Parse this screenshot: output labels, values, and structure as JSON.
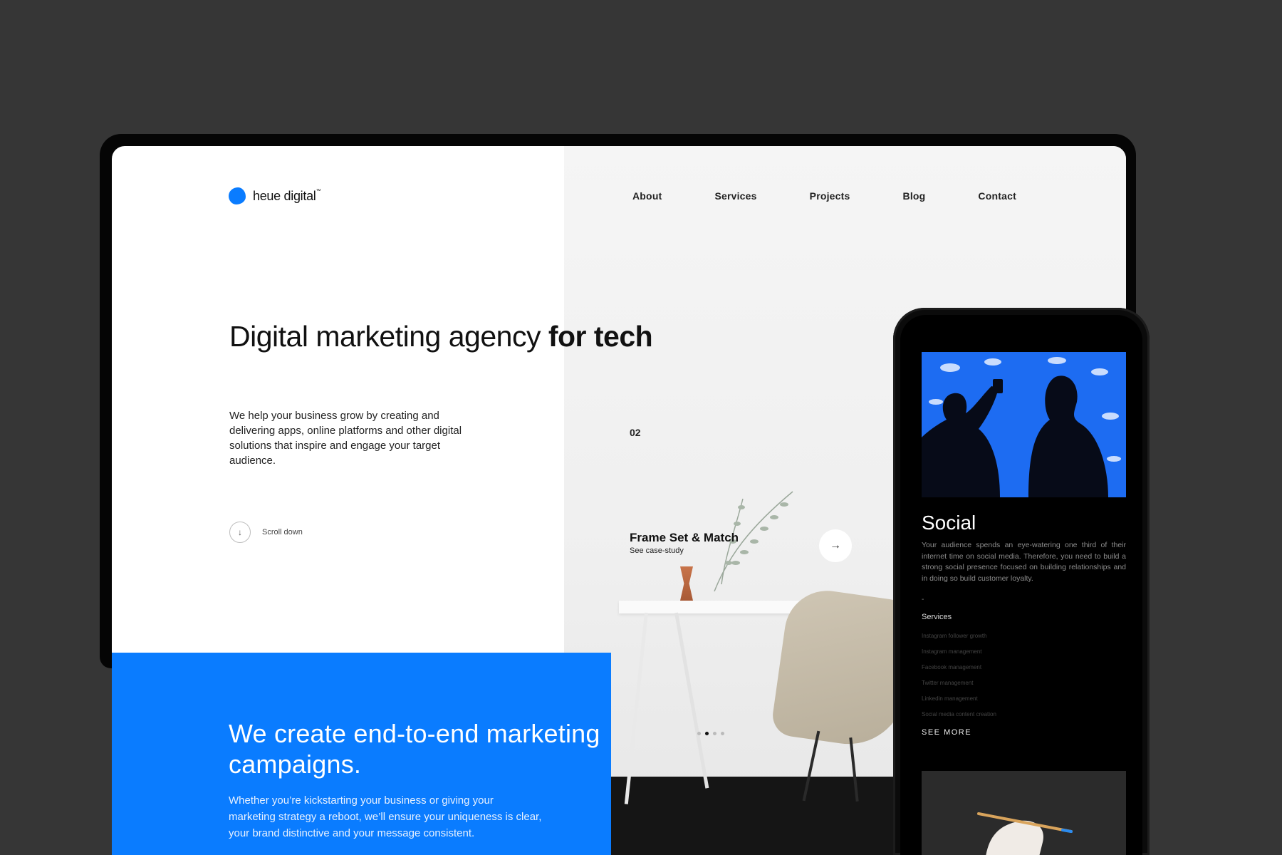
{
  "brand": {
    "name": "heue digital",
    "tm": "™",
    "accent": "#0a7cff"
  },
  "nav": {
    "items": [
      "About",
      "Services",
      "Projects",
      "Blog",
      "Contact"
    ]
  },
  "hero": {
    "title_plain": "Digital marketing agency ",
    "title_bold": "for tech",
    "subtitle": "We help your business grow by creating and delivering apps, online platforms and other digital solutions that inspire and engage your target audience.",
    "scroll_label": "Scroll down",
    "scroll_icon": "arrow-down-icon"
  },
  "slider": {
    "number": "02",
    "title": "Frame Set & Match",
    "subtitle": "See case-study",
    "arrow_icon": "arrow-right-icon",
    "dots": 4,
    "active_dot": 2
  },
  "campaign": {
    "title": "We create end-to-end marketing campaigns.",
    "text": "Whether you’re kickstarting your business or giving your marketing strategy a reboot, we’ll ensure your uniqueness is clear, your brand distinctive and your message consistent."
  },
  "phone": {
    "heading": "Social",
    "description": "Your audience spends an eye-watering one third of their internet time on social media. Therefore, you need to build a strong social presence focused on building relationships and in doing so build customer loyalty.",
    "dash": "-",
    "services_label": "Services",
    "services": [
      "Instagram follower growth",
      "Instagram management",
      "Facebook management",
      "Twitter management",
      "Linkedin management",
      "Social media content creation"
    ],
    "see_more": "SEE MORE"
  }
}
